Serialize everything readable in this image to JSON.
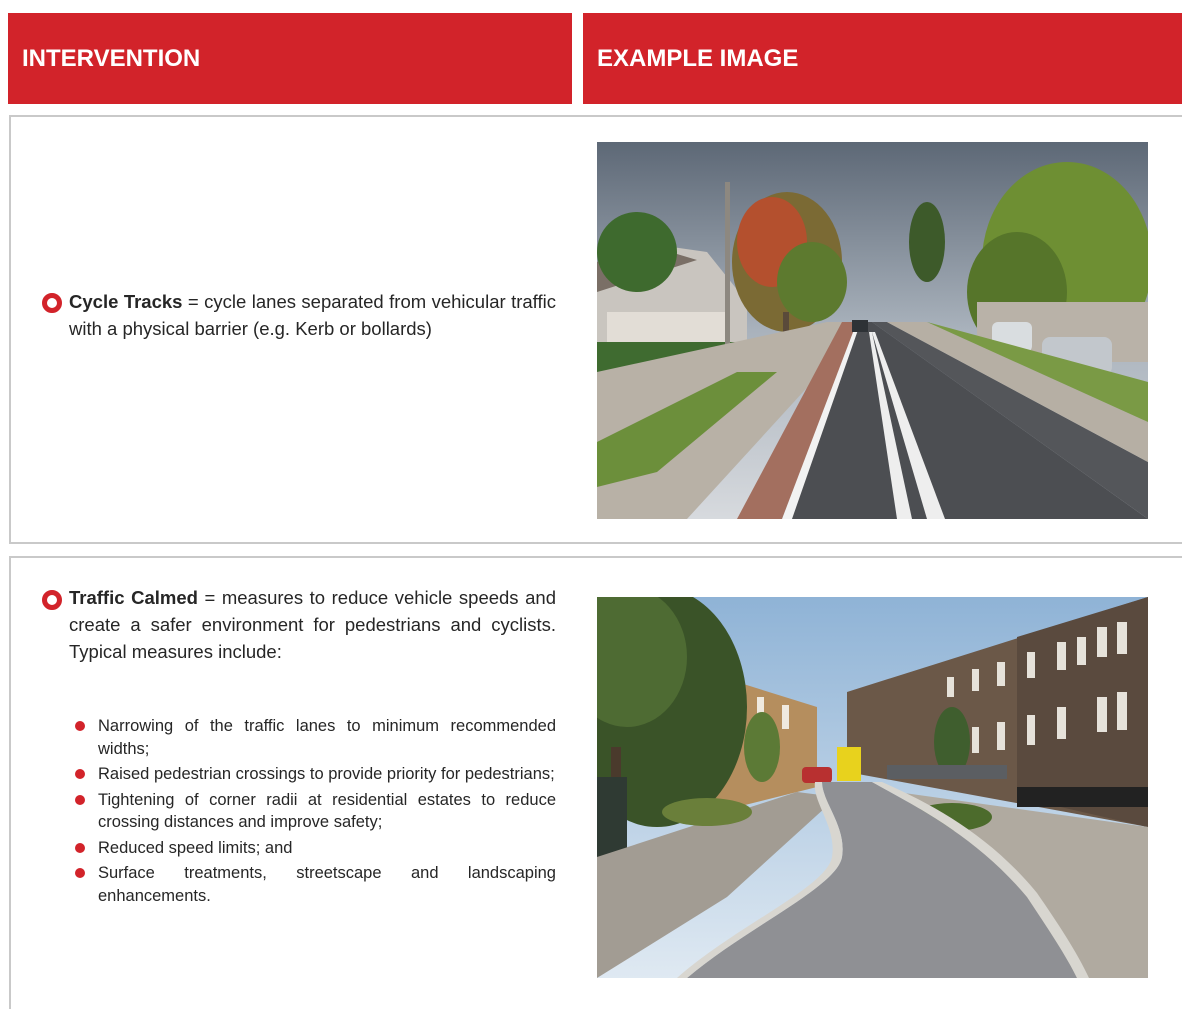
{
  "header": {
    "col1": "INTERVENTION",
    "col2": "EXAMPLE IMAGE"
  },
  "cycle_tracks": {
    "term": "Cycle Tracks",
    "description": " = cycle lanes separated from vehicular traffic with a physical barrier (e.g. Kerb or bollards)"
  },
  "traffic_calmed": {
    "term": "Traffic Calmed",
    "description": " = measures to reduce vehicle speeds and create a safer environment for pedestrians and cyclists. Typical measures include:",
    "measures": [
      "Narrowing of the traffic lanes to minimum recommended widths;",
      "Raised pedestrian crossings to provide priority for pedestrians;",
      "Tightening of corner radii at residential estates to reduce crossing distances and improve safety;",
      "Reduced speed limits; and",
      "Surface treatments, streetscape and landscaping enhancements."
    ]
  },
  "colors": {
    "accent": "#d2232a",
    "border": "#c9c9c9"
  },
  "icons": {
    "bullet": "ring-bullet-icon",
    "sub_bullet": "dot-bullet-icon"
  }
}
